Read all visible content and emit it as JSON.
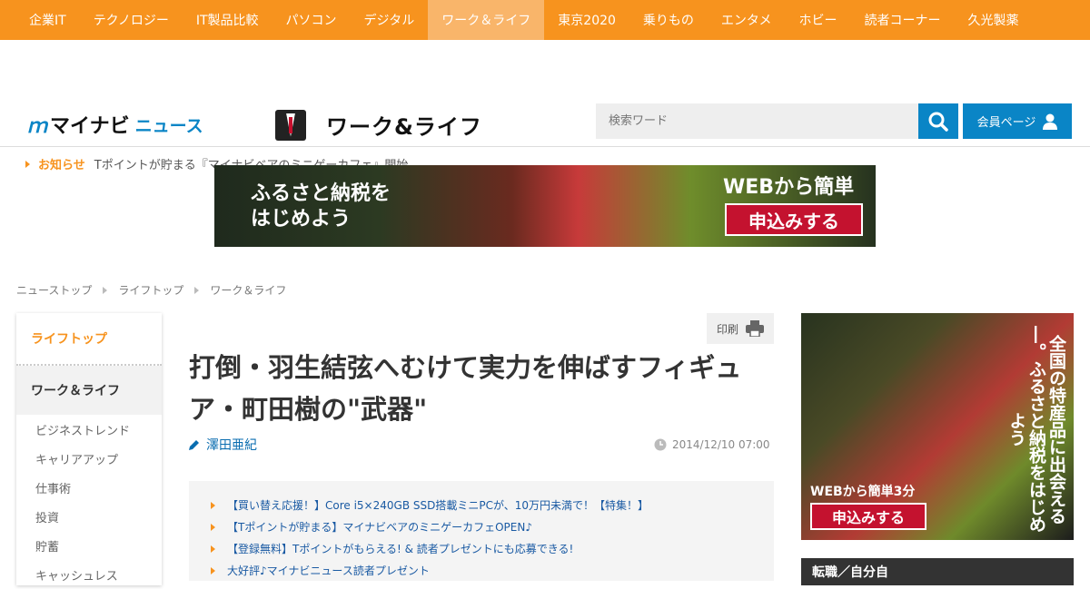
{
  "topnav": {
    "items": [
      "企業IT",
      "テクノロジー",
      "IT製品比較",
      "パソコン",
      "デジタル",
      "ワーク＆ライフ",
      "東京2020",
      "乗りもの",
      "エンタメ",
      "ホビー",
      "読者コーナー",
      "久光製薬"
    ],
    "active_index": 5
  },
  "header": {
    "logo_mark": "ｍ",
    "logo_text": "マイナビ",
    "logo_news": "ニュース",
    "section_title": "ワーク&ライフ",
    "search_placeholder": "検索ワード",
    "member_label": "会員ページ"
  },
  "notice": {
    "label": "お知らせ",
    "text": "Tポイントが貯まる『マイナビベアのミニゲーカフェ』開始"
  },
  "banner": {
    "line1": "ふるさと納税を",
    "line2": "はじめよう",
    "right_text": "WEBから簡単",
    "cta": "申込みする"
  },
  "breadcrumb": [
    "ニューストップ",
    "ライフトップ",
    "ワーク＆ライフ"
  ],
  "sidebar": {
    "top": "ライフトップ",
    "current": "ワーク＆ライフ",
    "subs": [
      "ビジネストレンド",
      "キャリアアップ",
      "仕事術",
      "投資",
      "貯蓄",
      "キャッシュレス"
    ]
  },
  "article": {
    "print_label": "印刷",
    "title": "打倒・羽生結弦へむけて実力を伸ばすフィギュア・町田樹の\"武器\"",
    "author": "澤田亜紀",
    "date": "2014/12/10 07:00"
  },
  "promo_links": [
    "【買い替え応援！】Core i5×240GB SSD搭載ミニPCが、10万円未満で！【特集！】",
    "【Tポイントが貯まる】マイナビベアのミニゲーカフェOPEN♪",
    "【登録無料】Tポイントがもらえる! & 読者プレゼントにも応募できる!",
    "大好評♪マイナビニュース読者プレゼント"
  ],
  "side_ad": {
    "vertical_text": "全国の特産品に出会える―。ふるさと納税をはじめよう",
    "text": "WEBから簡単3分",
    "cta": "申込みする"
  },
  "side_box": {
    "title": "転職／自分自"
  },
  "colors": {
    "accent": "#f7931e",
    "brand_blue": "#0a85c6"
  }
}
